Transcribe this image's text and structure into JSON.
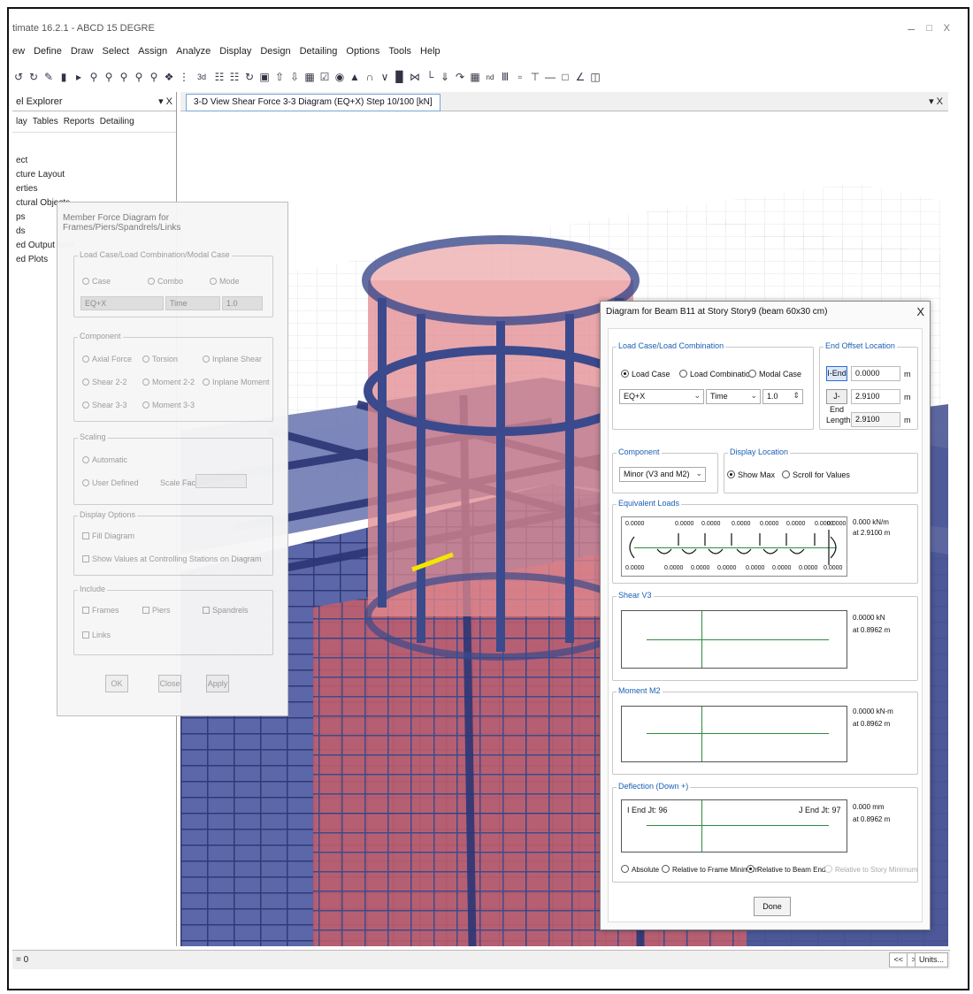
{
  "app": {
    "title": "timate 16.2.1 - ABCD 15 DEGRE",
    "minimize": "–",
    "restore": "□",
    "close": "X"
  },
  "menu": [
    "ew",
    "Define",
    "Draw",
    "Select",
    "Assign",
    "Analyze",
    "Display",
    "Design",
    "Detailing",
    "Options",
    "Tools",
    "Help"
  ],
  "toolbar_icons": [
    "undo-icon",
    "redo-icon",
    "pencil-icon",
    "lock-icon",
    "play-icon",
    "zoom-in-icon",
    "zoom-out-icon",
    "zoom-window-icon",
    "zoom-prev-icon",
    "zoom-fit-icon",
    "3d-view-icon",
    "grid-icon",
    "3d-label",
    "refresh-icon",
    "camera-icon",
    "arrow-up-icon",
    "arrow-down-icon",
    "plan-icon",
    "elevation-icon",
    "rubber-icon",
    "section-icon",
    "beam-icon",
    "column-icon",
    "brace-icon",
    "wall-icon",
    "load-icon",
    "dim-icon",
    "text-icon",
    "table-icon",
    "link-icon"
  ],
  "explorer": {
    "title": "el Explorer",
    "close": "▾ X",
    "tabs": [
      "lay",
      "Tables",
      "Reports",
      "Detailing"
    ],
    "tree": [
      "ect",
      "cture Layout",
      "erties",
      "ctural Objects",
      "ps",
      "ds",
      "ed Output Item",
      "ed Plots"
    ]
  },
  "view": {
    "tab_label": "3-D View   Shear Force 3-3 Diagram   (EQ+X) Step 10/100 [kN]",
    "controls": "▾ X"
  },
  "member_force_dialog": {
    "title": "Member Force Diagram for Frames/Piers/Spandrels/Links",
    "load_group": "Load Case/Load Combination/Modal Case",
    "case": "Case",
    "combo": "Combo",
    "mode": "Mode",
    "case_value": "EQ+X",
    "time_value": "Time",
    "step_value": "1.0",
    "component_group": "Component",
    "axial": "Axial Force",
    "torsion": "Torsion",
    "inplane_shear": "Inplane Shear",
    "shear22": "Shear 2-2",
    "moment22": "Moment 2-2",
    "inplane_moment": "Inplane Moment",
    "shear33": "Shear 3-3",
    "moment33": "Moment 3-3",
    "scaling_group": "Scaling",
    "automatic": "Automatic",
    "user_defined": "User Defined",
    "scale_factor": "Scale Factor",
    "display_group": "Display Options",
    "fill_diagram": "Fill Diagram",
    "show_values": "Show Values at Controlling Stations on Diagram",
    "include_group": "Include",
    "frames": "Frames",
    "piers": "Piers",
    "spandrels": "Spandrels",
    "links": "Links",
    "ok": "OK",
    "close": "Close",
    "apply": "Apply"
  },
  "beam_dialog": {
    "title": "Diagram for Beam B11 at Story Story9 (beam 60x30 cm)",
    "close": "X",
    "load_group": "Load Case/Load Combination",
    "load_case": "Load Case",
    "load_combination": "Load Combination",
    "modal_case": "Modal Case",
    "case_value": "EQ+X",
    "time_value": "Time",
    "step_value": "1.0",
    "end_offset_group": "End Offset Location",
    "i_end": "I-End",
    "i_end_value": "0.0000",
    "j_end": "J-End",
    "j_end_value": "2.9100",
    "length": "Length",
    "length_value": "2.9100",
    "unit_m": "m",
    "component_group": "Component",
    "component_value": "Minor (V3 and M2)",
    "display_location_group": "Display Location",
    "show_max": "Show Max",
    "scroll_values": "Scroll for Values",
    "equiv_group": "Equivalent Loads",
    "equiv_top_values": [
      "0.0000",
      "0.0000",
      "0.0000",
      "0.0000",
      "0.0000",
      "0.0000",
      "0.0000",
      "0.0000"
    ],
    "equiv_bottom_values": [
      "0.0000",
      "0.0000",
      "0.0000",
      "0.0000",
      "0.0000",
      "0.0000",
      "0.0000",
      "0.0000"
    ],
    "equiv_readout_1": "0.000 kN/m",
    "equiv_readout_2": "at 2.9100 m",
    "shear_group": "Shear V3",
    "shear_readout_1": "0.0000 kN",
    "shear_readout_2": "at 0.8962 m",
    "moment_group": "Moment M2",
    "moment_readout_1": "0.0000 kN-m",
    "moment_readout_2": "at 0.8962 m",
    "deflection_group": "Deflection (Down +)",
    "i_end_joint": "I End Jt: 96",
    "j_end_joint": "J End Jt: 97",
    "deflection_readout_1": "0.000 mm",
    "deflection_readout_2": "at 0.8962 m",
    "absolute": "Absolute",
    "rel_frame_min": "Relative to Frame Minimum",
    "rel_beam_ends": "Relative to Beam Ends",
    "rel_story_min": "Relative to Story Minimum",
    "done": "Done"
  },
  "status": {
    "left": "= 0",
    "prev": "<<",
    "next": ">>",
    "units": "Units..."
  },
  "colors": {
    "frame_blue": "#3b4a8c",
    "core_red": "#d96a6a",
    "highlight_yellow": "#f2e600",
    "diagram_green": "#2e8b3e",
    "accent_blue": "#1a5fb4"
  }
}
